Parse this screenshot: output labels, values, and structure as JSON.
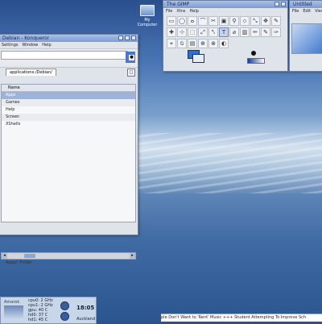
{
  "desktop": {
    "icons": [
      {
        "label": "My\nComputer",
        "icon": "computer-icon"
      }
    ]
  },
  "konqueror": {
    "title": "Debian - Konqueror",
    "menu": [
      "Settings",
      "Window",
      "Help"
    ],
    "tab_label": "applications:/Debian/",
    "list_header": "Name",
    "items": [
      "Apps",
      "Games",
      "Help",
      "Screen",
      "XShells"
    ],
    "selected_item": "Apps",
    "status": "Apps/: Folder",
    "go_glyph": "●",
    "tab_glyph": "□",
    "logo_text": "K"
  },
  "gimp_toolbox": {
    "title": "The GIMP",
    "menu": [
      "File",
      "Xtns",
      "Help"
    ],
    "tools": [
      "▭",
      "◯",
      "ⴰ",
      "⌒",
      "✂",
      "▣",
      "⚲",
      "⬦",
      "⤡",
      "✥",
      "✎",
      "✚",
      "⊹",
      "⬚",
      "⤢",
      "⤣",
      "T",
      "⌀",
      "▥",
      "✏",
      "✎",
      "✑",
      "⌖",
      "⍉",
      "▤",
      "⊕",
      "⊗",
      "◐"
    ],
    "active_tool_index": 16,
    "fg_color": "#2d6fd1",
    "bg_color": "#e4ecf7"
  },
  "image_window": {
    "title": "Untitled",
    "menu": [
      "File",
      "Edit",
      "View"
    ]
  },
  "system_monitor": {
    "label": "Amarok",
    "stats": [
      "cpu0: 2 GHz",
      "cpu1: 2 GHz",
      "gpu: 40 C",
      "hd0: 37 C",
      "hd1: 45 C"
    ],
    "time": "18:05",
    "city": "Auckland"
  },
  "ticker": {
    "text": "ple Don't Want to 'Rent' Music +++ Student Attempting To Improve Sch"
  }
}
